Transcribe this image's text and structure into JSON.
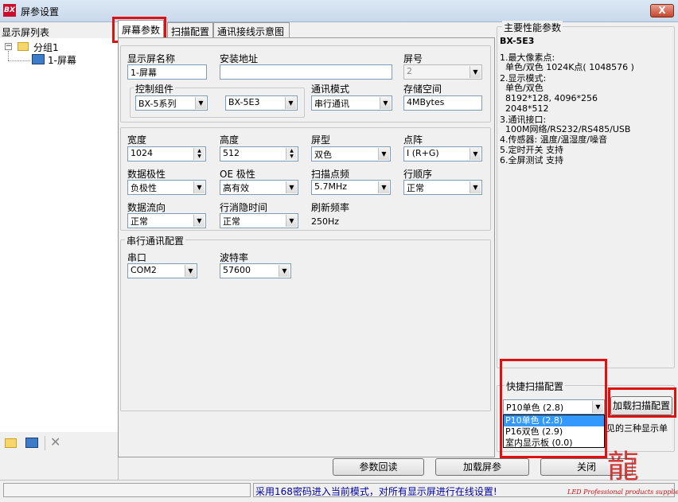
{
  "window": {
    "title": "屏参设置",
    "app_icon": "BX",
    "close_label": "X"
  },
  "left": {
    "tree_label": "显示屏列表",
    "group_label": "分组1",
    "screen_label": "1-屏幕"
  },
  "tabs": [
    {
      "label": "屏幕参数"
    },
    {
      "label": "扫描配置"
    },
    {
      "label": "通讯接线示意图"
    }
  ],
  "basic": {
    "name_label": "显示屏名称",
    "name_value": "1-屏幕",
    "address_label": "安装地址",
    "address_value": "",
    "screen_no_label": "屏号",
    "screen_no_value": "2",
    "control_group_label": "控制组件",
    "series_value": "BX-5系列",
    "model_value": "BX-5E3",
    "comm_mode_label": "通讯模式",
    "comm_mode_value": "串行通讯",
    "storage_label": "存储空间",
    "storage_value": "4MBytes"
  },
  "display": {
    "width_label": "宽度",
    "width_value": "1024",
    "height_label": "高度",
    "height_value": "512",
    "type_label": "屏型",
    "type_value": "双色",
    "matrix_label": "点阵",
    "matrix_value": "I (R+G)",
    "polarity_label": "数据极性",
    "polarity_value": "负极性",
    "oe_label": "OE 极性",
    "oe_value": "高有效",
    "scan_freq_label": "扫描点频",
    "scan_freq_value": "5.7MHz",
    "row_order_label": "行顺序",
    "row_order_value": "正常",
    "flow_label": "数据流向",
    "flow_value": "正常",
    "blank_label": "行消隐时间",
    "blank_value": "正常",
    "refresh_label": "刷新频率",
    "refresh_value": "250Hz"
  },
  "serial": {
    "title": "串行通讯配置",
    "port_label": "串口",
    "port_value": "COM2",
    "baud_label": "波特率",
    "baud_value": "57600"
  },
  "specs": {
    "title": "主要性能参数",
    "model": "BX-5E3",
    "lines": [
      "1.最大像素点:",
      "  单色/双色 1024K点( 1048576 )",
      "2.显示模式:",
      "  单色/双色",
      "  8192*128, 4096*256",
      "  2048*512",
      "3.通讯接口:",
      "  100M网络/RS232/RS485/USB",
      "4.传感器: 温度/温湿度/噪音",
      "5.定时开关 支持",
      "6.全屏测试 支持"
    ]
  },
  "quick_scan": {
    "title": "快捷扫描配置",
    "selected": "P10单色 (2.8)",
    "options": [
      "P10单色 (2.8)",
      "P16双色 (2.9)",
      "室内显示板 (0.0)"
    ],
    "load_button": "加载扫描配置",
    "hint_text": "见的三种显示单"
  },
  "buttons": {
    "readback": "参数回读",
    "load": "加载屏参",
    "close": "关闭"
  },
  "status": {
    "message": "采用168密码进入当前模式，对所有显示屏进行在线设置!"
  },
  "watermark": {
    "logo_text": "LED Professional products suppliers"
  }
}
